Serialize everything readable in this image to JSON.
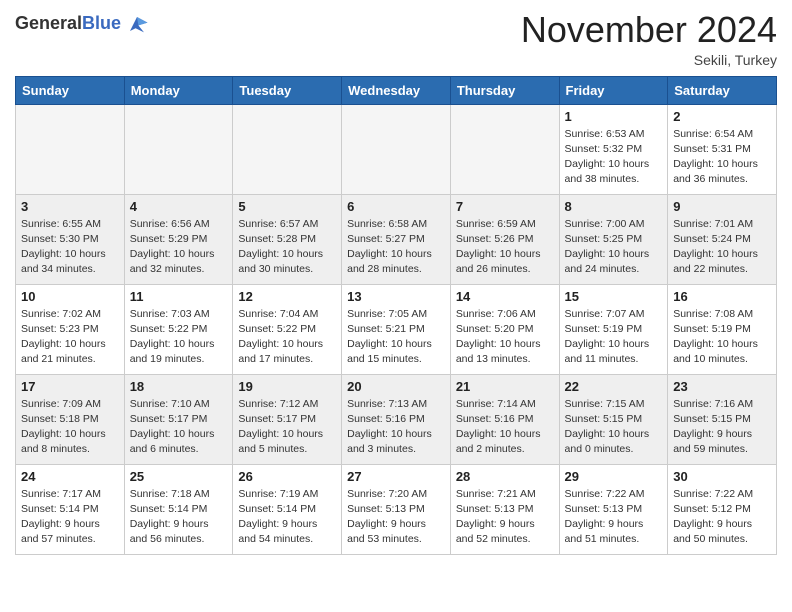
{
  "header": {
    "logo_line1": "General",
    "logo_line2": "Blue",
    "month": "November 2024",
    "location": "Sekili, Turkey"
  },
  "weekdays": [
    "Sunday",
    "Monday",
    "Tuesday",
    "Wednesday",
    "Thursday",
    "Friday",
    "Saturday"
  ],
  "weeks": [
    [
      {
        "day": "",
        "info": ""
      },
      {
        "day": "",
        "info": ""
      },
      {
        "day": "",
        "info": ""
      },
      {
        "day": "",
        "info": ""
      },
      {
        "day": "",
        "info": ""
      },
      {
        "day": "1",
        "info": "Sunrise: 6:53 AM\nSunset: 5:32 PM\nDaylight: 10 hours\nand 38 minutes."
      },
      {
        "day": "2",
        "info": "Sunrise: 6:54 AM\nSunset: 5:31 PM\nDaylight: 10 hours\nand 36 minutes."
      }
    ],
    [
      {
        "day": "3",
        "info": "Sunrise: 6:55 AM\nSunset: 5:30 PM\nDaylight: 10 hours\nand 34 minutes."
      },
      {
        "day": "4",
        "info": "Sunrise: 6:56 AM\nSunset: 5:29 PM\nDaylight: 10 hours\nand 32 minutes."
      },
      {
        "day": "5",
        "info": "Sunrise: 6:57 AM\nSunset: 5:28 PM\nDaylight: 10 hours\nand 30 minutes."
      },
      {
        "day": "6",
        "info": "Sunrise: 6:58 AM\nSunset: 5:27 PM\nDaylight: 10 hours\nand 28 minutes."
      },
      {
        "day": "7",
        "info": "Sunrise: 6:59 AM\nSunset: 5:26 PM\nDaylight: 10 hours\nand 26 minutes."
      },
      {
        "day": "8",
        "info": "Sunrise: 7:00 AM\nSunset: 5:25 PM\nDaylight: 10 hours\nand 24 minutes."
      },
      {
        "day": "9",
        "info": "Sunrise: 7:01 AM\nSunset: 5:24 PM\nDaylight: 10 hours\nand 22 minutes."
      }
    ],
    [
      {
        "day": "10",
        "info": "Sunrise: 7:02 AM\nSunset: 5:23 PM\nDaylight: 10 hours\nand 21 minutes."
      },
      {
        "day": "11",
        "info": "Sunrise: 7:03 AM\nSunset: 5:22 PM\nDaylight: 10 hours\nand 19 minutes."
      },
      {
        "day": "12",
        "info": "Sunrise: 7:04 AM\nSunset: 5:22 PM\nDaylight: 10 hours\nand 17 minutes."
      },
      {
        "day": "13",
        "info": "Sunrise: 7:05 AM\nSunset: 5:21 PM\nDaylight: 10 hours\nand 15 minutes."
      },
      {
        "day": "14",
        "info": "Sunrise: 7:06 AM\nSunset: 5:20 PM\nDaylight: 10 hours\nand 13 minutes."
      },
      {
        "day": "15",
        "info": "Sunrise: 7:07 AM\nSunset: 5:19 PM\nDaylight: 10 hours\nand 11 minutes."
      },
      {
        "day": "16",
        "info": "Sunrise: 7:08 AM\nSunset: 5:19 PM\nDaylight: 10 hours\nand 10 minutes."
      }
    ],
    [
      {
        "day": "17",
        "info": "Sunrise: 7:09 AM\nSunset: 5:18 PM\nDaylight: 10 hours\nand 8 minutes."
      },
      {
        "day": "18",
        "info": "Sunrise: 7:10 AM\nSunset: 5:17 PM\nDaylight: 10 hours\nand 6 minutes."
      },
      {
        "day": "19",
        "info": "Sunrise: 7:12 AM\nSunset: 5:17 PM\nDaylight: 10 hours\nand 5 minutes."
      },
      {
        "day": "20",
        "info": "Sunrise: 7:13 AM\nSunset: 5:16 PM\nDaylight: 10 hours\nand 3 minutes."
      },
      {
        "day": "21",
        "info": "Sunrise: 7:14 AM\nSunset: 5:16 PM\nDaylight: 10 hours\nand 2 minutes."
      },
      {
        "day": "22",
        "info": "Sunrise: 7:15 AM\nSunset: 5:15 PM\nDaylight: 10 hours\nand 0 minutes."
      },
      {
        "day": "23",
        "info": "Sunrise: 7:16 AM\nSunset: 5:15 PM\nDaylight: 9 hours\nand 59 minutes."
      }
    ],
    [
      {
        "day": "24",
        "info": "Sunrise: 7:17 AM\nSunset: 5:14 PM\nDaylight: 9 hours\nand 57 minutes."
      },
      {
        "day": "25",
        "info": "Sunrise: 7:18 AM\nSunset: 5:14 PM\nDaylight: 9 hours\nand 56 minutes."
      },
      {
        "day": "26",
        "info": "Sunrise: 7:19 AM\nSunset: 5:14 PM\nDaylight: 9 hours\nand 54 minutes."
      },
      {
        "day": "27",
        "info": "Sunrise: 7:20 AM\nSunset: 5:13 PM\nDaylight: 9 hours\nand 53 minutes."
      },
      {
        "day": "28",
        "info": "Sunrise: 7:21 AM\nSunset: 5:13 PM\nDaylight: 9 hours\nand 52 minutes."
      },
      {
        "day": "29",
        "info": "Sunrise: 7:22 AM\nSunset: 5:13 PM\nDaylight: 9 hours\nand 51 minutes."
      },
      {
        "day": "30",
        "info": "Sunrise: 7:22 AM\nSunset: 5:12 PM\nDaylight: 9 hours\nand 50 minutes."
      }
    ]
  ]
}
